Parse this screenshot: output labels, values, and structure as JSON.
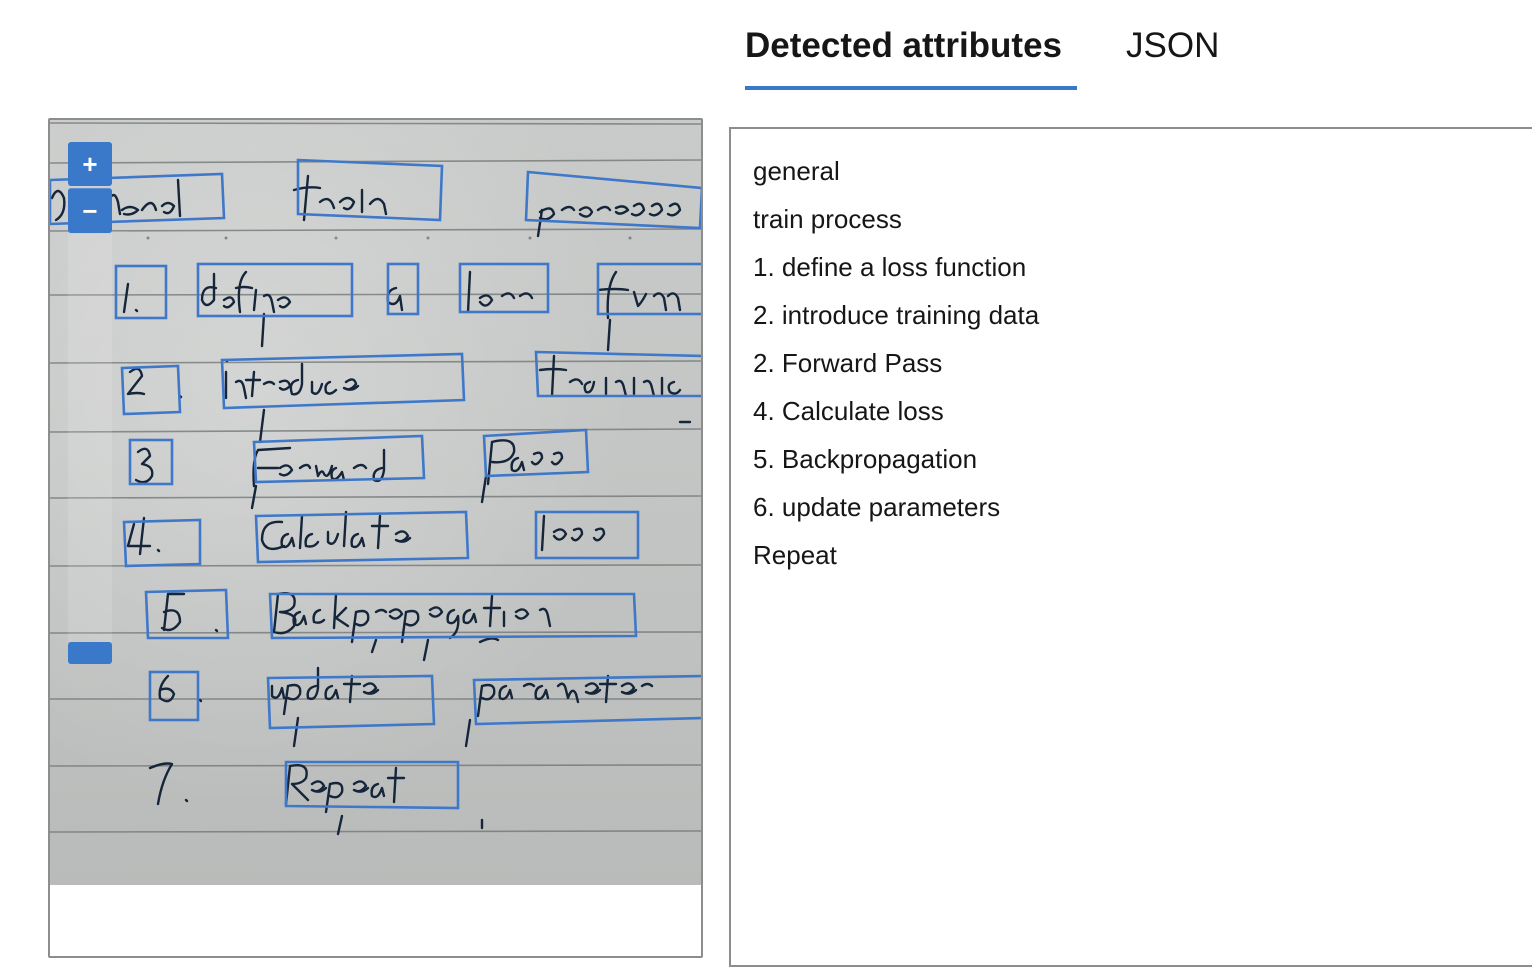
{
  "tabs": [
    {
      "label": "Detected attributes",
      "active": true
    },
    {
      "label": "JSON",
      "active": false
    }
  ],
  "viewer": {
    "zoom_in_label": "+",
    "zoom_out_label": "−",
    "icons": {
      "zoom_in": "plus-icon",
      "zoom_out": "minus-icon"
    }
  },
  "attributes": [
    "general",
    "train process",
    "1. define a loss function",
    "2. introduce training data",
    "2. Forward Pass",
    "4. Calculate loss",
    "5. Backpropagation",
    "6. update parameters",
    "Repeat"
  ],
  "colors": {
    "accent": "#3a78c9",
    "text": "#161616",
    "border": "#8d8d8d",
    "paper": "#c4c6c5"
  }
}
